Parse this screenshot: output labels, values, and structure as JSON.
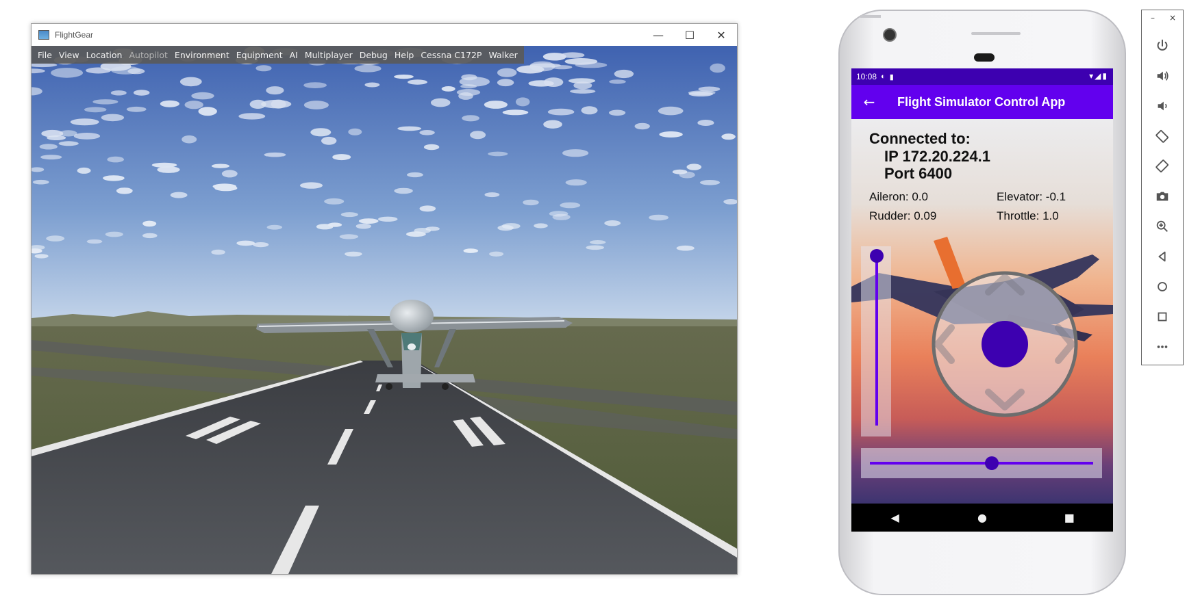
{
  "flightgear": {
    "window_title": "FlightGear",
    "controls": {
      "minimize": "—",
      "maximize": "☐",
      "close": "✕"
    },
    "menu": [
      {
        "label": "File",
        "enabled": true
      },
      {
        "label": "View",
        "enabled": true
      },
      {
        "label": "Location",
        "enabled": true
      },
      {
        "label": "Autopilot",
        "enabled": false
      },
      {
        "label": "Environment",
        "enabled": true
      },
      {
        "label": "Equipment",
        "enabled": true
      },
      {
        "label": "AI",
        "enabled": true
      },
      {
        "label": "Multiplayer",
        "enabled": true
      },
      {
        "label": "Debug",
        "enabled": true
      },
      {
        "label": "Help",
        "enabled": true
      },
      {
        "label": "Cessna C172P",
        "enabled": true
      },
      {
        "label": "Walker",
        "enabled": true
      }
    ],
    "colors": {
      "sky_top": "#4a6db8",
      "sky_bottom": "#c7d6ea",
      "grass": "#5d6641",
      "runway": "#4b4d52",
      "aircraft": "#8f969c"
    }
  },
  "phone": {
    "status_bar": {
      "time": "10:08",
      "right_icons": "wifi signal battery"
    },
    "app_bar": {
      "title": "Flight Simulator Control App",
      "back_icon": "arrow-back-icon"
    },
    "connection": {
      "heading": "Connected to:",
      "ip_line": "IP 172.20.224.1",
      "port_line": "Port 6400"
    },
    "stats": {
      "aileron": "Aileron: 0.0",
      "elevator": "Elevator: -0.1",
      "rudder": "Rudder: 0.09",
      "throttle": "Throttle: 1.0"
    },
    "controls_state": {
      "throttle_slider_fraction": 1.0,
      "rudder_slider_fraction": 0.545
    },
    "colors": {
      "primary": "#6200ee",
      "primary_dark": "#3d00b0",
      "thumb": "#3d00b0"
    },
    "nav": [
      "back-icon",
      "home-icon",
      "recents-icon"
    ]
  },
  "emulator_toolbar": {
    "top": {
      "minimize": "–",
      "close": "×"
    },
    "buttons": [
      "power-icon",
      "volume-up-icon",
      "volume-down-icon",
      "rotate-left-icon",
      "rotate-right-icon",
      "camera-icon",
      "zoom-icon",
      "back-icon",
      "home-icon",
      "overview-icon",
      "more-icon"
    ]
  }
}
